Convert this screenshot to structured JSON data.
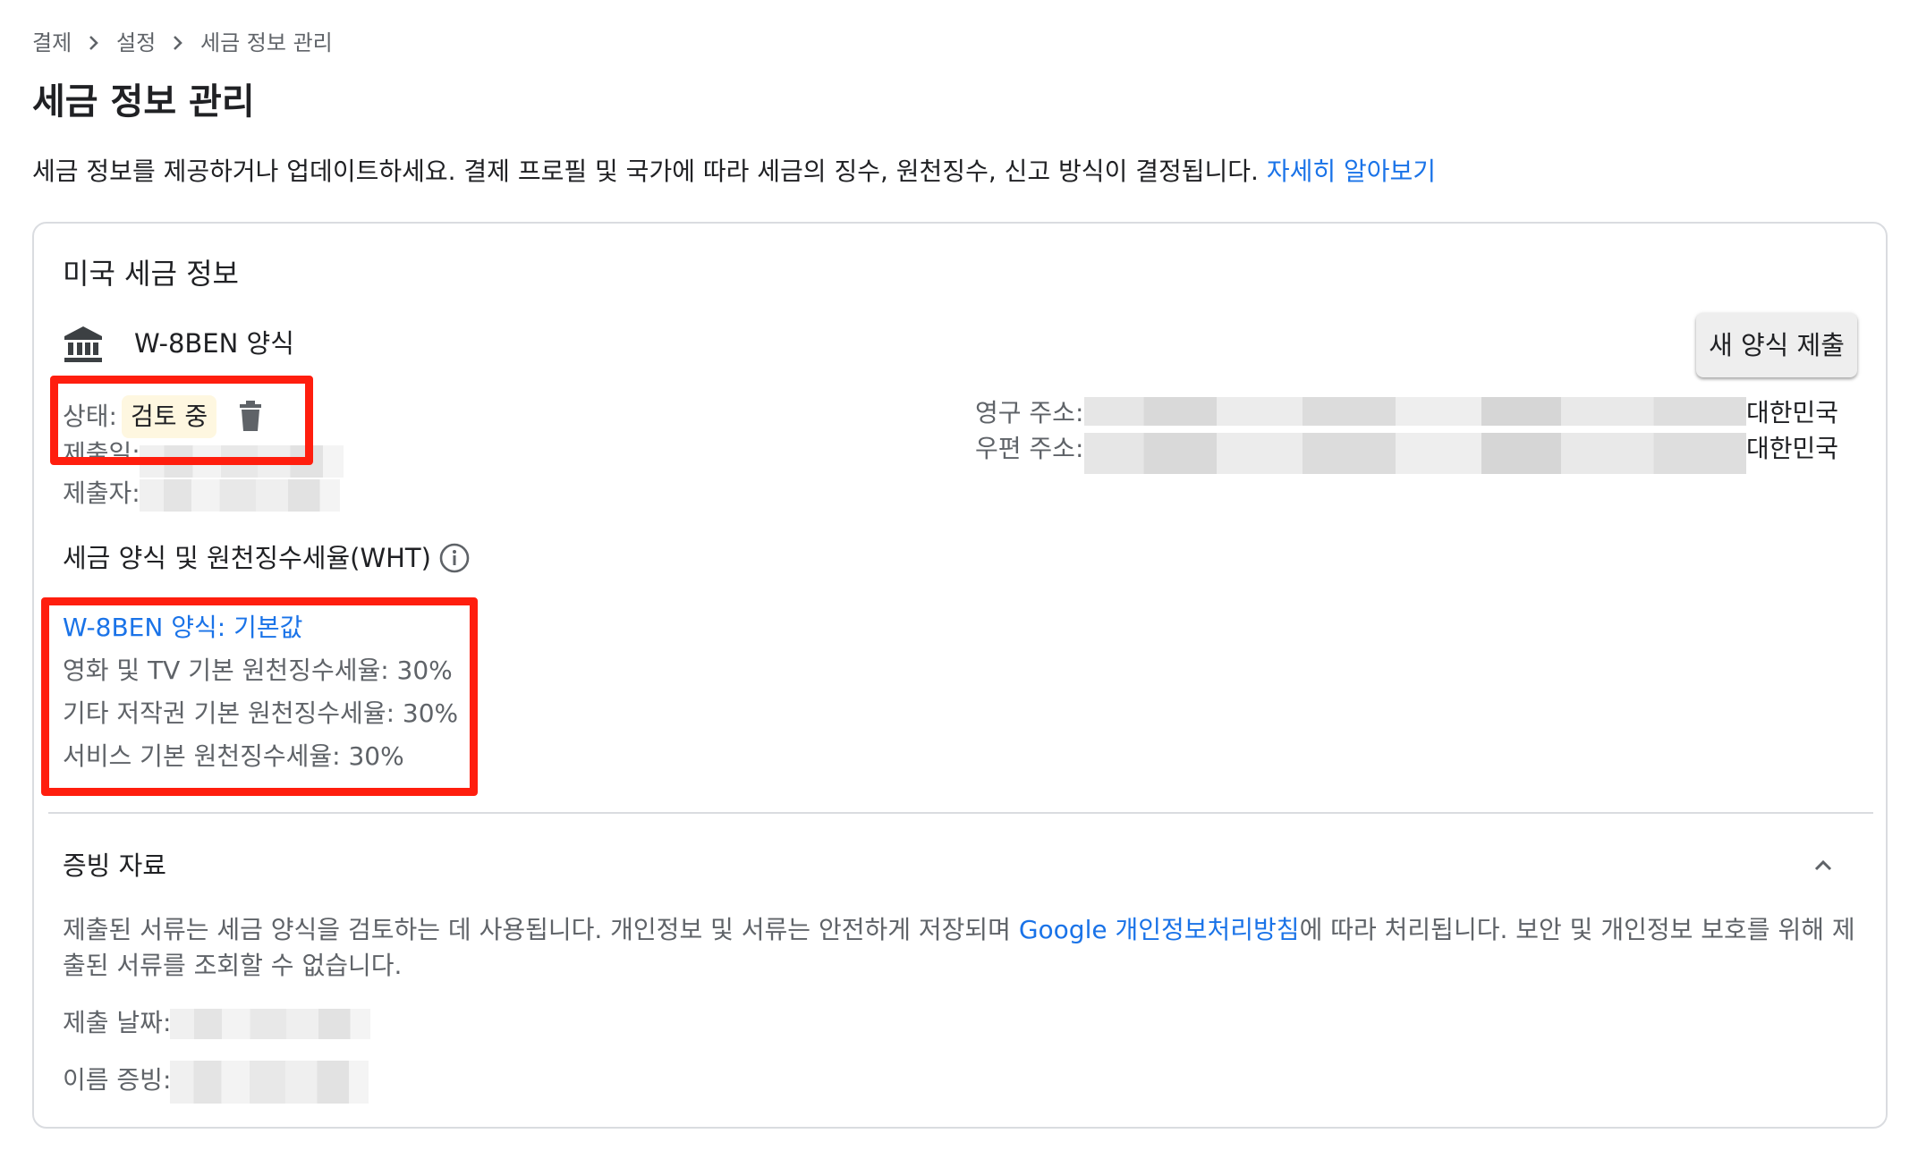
{
  "breadcrumb": {
    "items": [
      "결제",
      "설정",
      "세금 정보 관리"
    ]
  },
  "page": {
    "title": "세금 정보 관리",
    "intro_text": "세금 정보를 제공하거나 업데이트하세요. 결제 프로필 및 국가에 따라 세금의 징수, 원천징수, 신고 방식이 결정됩니다. ",
    "intro_link": "자세히 알아보기"
  },
  "card": {
    "title": "미국 세금 정보",
    "form": {
      "icon": "bank-icon",
      "name": "W-8BEN 양식",
      "new_form_button": "새 양식 제출",
      "status_label": "상태:",
      "status_value": "검토 중",
      "status_color": "#fef7e0",
      "delete_icon": "trash-icon",
      "submitted_date_label": "제출일:",
      "submitter_label": "제출자:",
      "permanent_address_label": "영구 주소:",
      "permanent_address_country": "대한민국",
      "mailing_address_label": "우편 주소:",
      "mailing_address_country": "대한민국"
    },
    "wht": {
      "title": "세금 양식 및 원천징수세율(WHT)",
      "info_icon": "info-icon",
      "default_link": "W-8BEN 양식: 기본값",
      "rates": [
        "영화 및 TV 기본 원천징수세율: 30%",
        "기타 저작권 기본 원천징수세율: 30%",
        "서비스 기본 원천징수세율: 30%"
      ]
    },
    "evidence": {
      "title": "증빙 자료",
      "chevron_icon": "chevron-up-icon",
      "para_before": "제출된 서류는 세금 양식을 검토하는 데 사용됩니다. 개인정보 및 서류는 안전하게 저장되며 ",
      "para_link": "Google 개인정보처리방침",
      "para_after": "에 따라 처리됩니다. 보안 및 개인정보 보호를 위해 제출된 서류를 조회할 수 없습니다.",
      "submission_date_label": "제출 날짜:",
      "name_proof_label": "이름 증빙:"
    }
  },
  "colors": {
    "link": "#1a73e8",
    "highlight_border": "#ff1e0e",
    "secondary_text": "#5f6368"
  }
}
